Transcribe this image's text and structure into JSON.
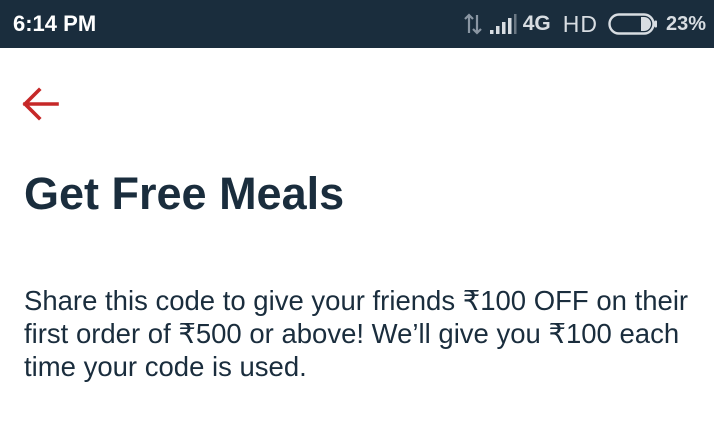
{
  "status_bar": {
    "time": "6:14 PM",
    "network": "4G",
    "hd": "HD",
    "battery": "23%",
    "background": "#1a2d3d"
  },
  "header": {
    "back_icon": "arrow-left-icon",
    "back_color": "#c62828"
  },
  "page": {
    "title": "Get Free Meals",
    "description": "Share this code to give your friends ₹100 OFF on their first order of ₹500 or above! We’ll give you ₹100 each time your code is used.",
    "text_color": "#1a2d3d"
  }
}
